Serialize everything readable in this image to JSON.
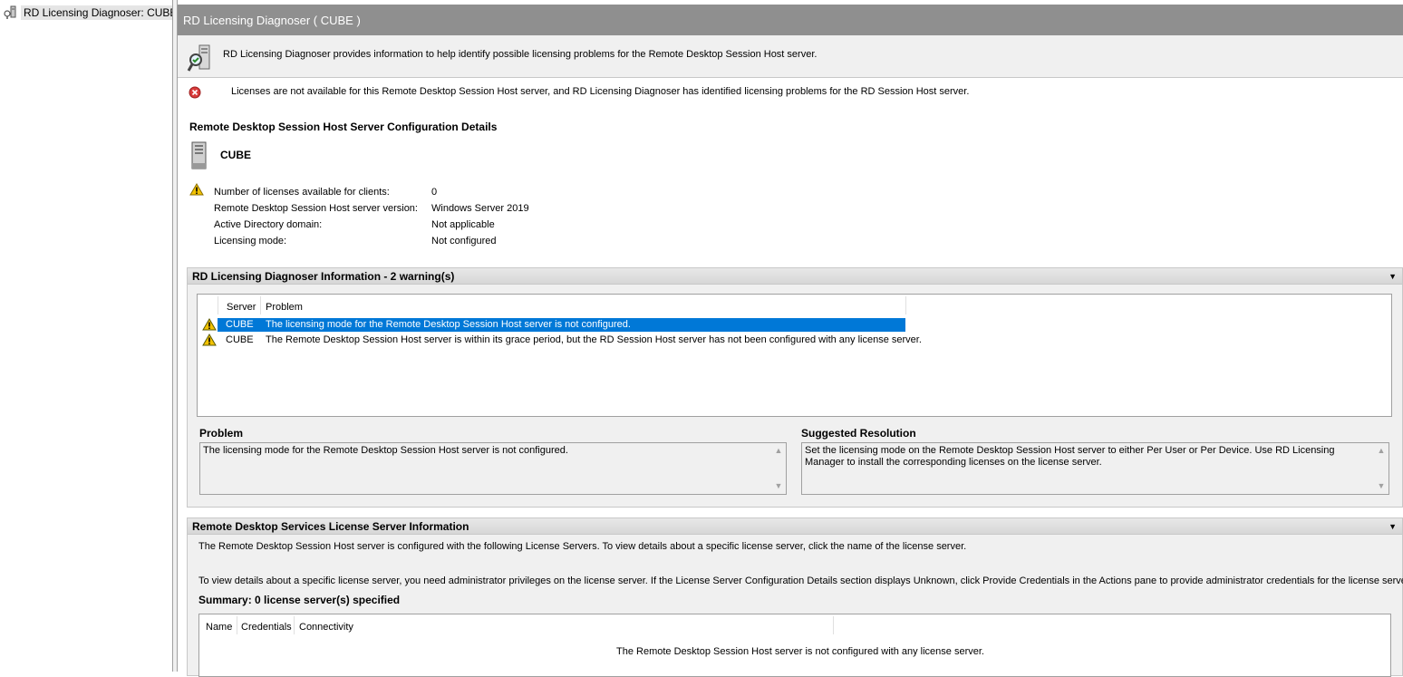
{
  "tree": {
    "root_label": "RD Licensing Diagnoser: CUBE"
  },
  "title": "RD Licensing Diagnoser ( CUBE )",
  "intro_text": "RD Licensing Diagnoser provides information to help identify possible licensing problems for the Remote Desktop Session Host server.",
  "error_text": "Licenses are not available for this Remote Desktop Session Host server, and RD Licensing Diagnoser has identified licensing problems for the RD Session Host server.",
  "config": {
    "title": "Remote Desktop Session Host Server Configuration Details",
    "server_name": "CUBE",
    "rows": [
      {
        "label": "Number of licenses available for clients:",
        "value": "0"
      },
      {
        "label": "Remote Desktop Session Host server version:",
        "value": "Windows Server 2019"
      },
      {
        "label": "Active Directory domain:",
        "value": "Not applicable"
      },
      {
        "label": "Licensing mode:",
        "value": "Not configured"
      }
    ]
  },
  "diag": {
    "header": "RD Licensing Diagnoser Information - 2 warning(s)",
    "columns": {
      "server": "Server",
      "problem": "Problem"
    },
    "rows": [
      {
        "server": "CUBE",
        "problem": "The licensing mode for the Remote Desktop Session Host server is not configured.",
        "selected": true
      },
      {
        "server": "CUBE",
        "problem": "The Remote Desktop Session Host server is within its grace period, but the RD Session Host server has not been configured with any license server.",
        "selected": false
      }
    ],
    "problem_label": "Problem",
    "problem_text": "The licensing mode for the Remote Desktop Session Host server is not configured.",
    "resolution_label": "Suggested Resolution",
    "resolution_text": "Set the licensing mode on the Remote Desktop Session Host server to either Per User or Per Device. Use RD Licensing Manager to install the corresponding licenses on the license server."
  },
  "ls": {
    "header": "Remote Desktop Services License Server Information",
    "desc1": "The Remote Desktop Session Host server is configured with the following License Servers. To view details about a specific license server, click the name of the license server.",
    "desc2": "To view details about a specific license server, you need administrator privileges on the license server. If the License Server Configuration Details section displays Unknown, click Provide Credentials in the Actions pane to provide administrator credentials for the license server.",
    "summary": "Summary: 0 license server(s) specified",
    "columns": {
      "name": "Name",
      "credentials": "Credentials",
      "connectivity": "Connectivity"
    },
    "empty_text": "The Remote Desktop Session Host server is not configured with any license server."
  },
  "colors": {
    "selection": "#0078d7",
    "title_bar": "#8f8f8f",
    "error": "#d83b3b",
    "warning": "#f2c200"
  }
}
